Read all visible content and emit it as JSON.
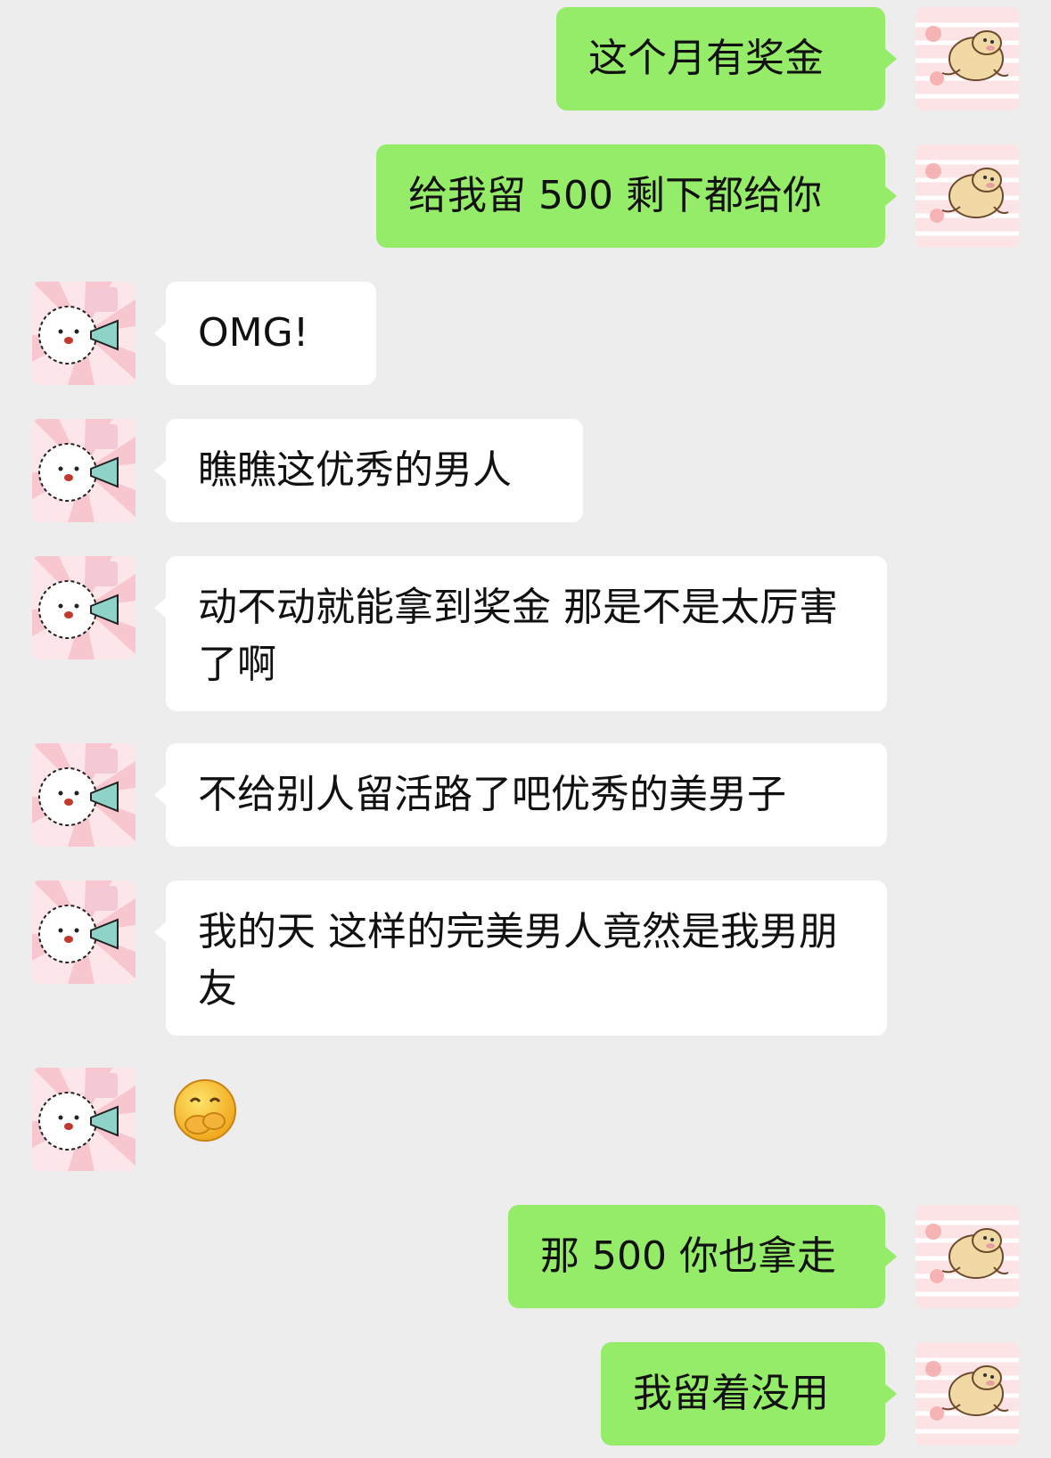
{
  "messages": [
    {
      "side": "right",
      "text": "这个月有奖金"
    },
    {
      "side": "right",
      "text": "给我留 500 剩下都给你"
    },
    {
      "side": "left",
      "text": "OMG!"
    },
    {
      "side": "left",
      "text": "瞧瞧这优秀的男人"
    },
    {
      "side": "left",
      "text": "动不动就能拿到奖金 那是不是太厉害了啊"
    },
    {
      "side": "left",
      "text": "不给别人留活路了吧优秀的美男子"
    },
    {
      "side": "left",
      "text": "我的天 这样的完美男人竟然是我男朋友"
    },
    {
      "side": "left",
      "emoji": "covering-mouth-laugh-emoji"
    },
    {
      "side": "right",
      "text": "那 500 你也拿走"
    },
    {
      "side": "right",
      "text": "我留着没用"
    }
  ],
  "avatars": {
    "self": "pig-sticker-avatar",
    "contact": "white-dog-megaphone-avatar"
  },
  "colors": {
    "background": "#ededed",
    "self_bubble": "#95ec69",
    "contact_bubble": "#ffffff"
  }
}
